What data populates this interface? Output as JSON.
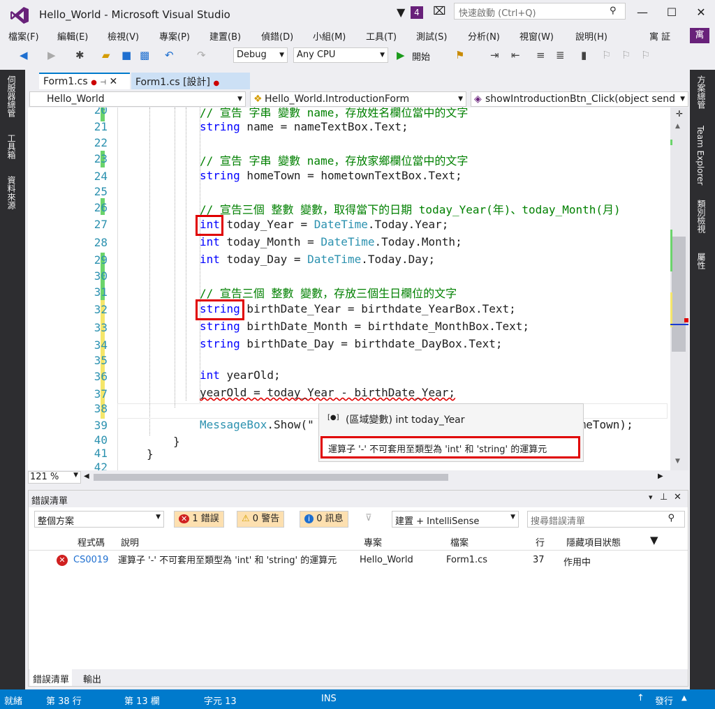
{
  "window": {
    "title": "Hello_World - Microsoft Visual Studio",
    "notif_count": "4",
    "quick_launch_placeholder": "快速啟動 (Ctrl+Q)",
    "user": "寓 証",
    "avatar": "寓"
  },
  "menu": [
    "檔案(F)",
    "編輯(E)",
    "檢視(V)",
    "專案(P)",
    "建置(B)",
    "偵錯(D)",
    "小組(M)",
    "工具(T)",
    "測試(S)",
    "分析(N)",
    "視窗(W)",
    "說明(H)"
  ],
  "toolbar": {
    "config": "Debug",
    "platform": "Any CPU",
    "start": "開始"
  },
  "left_tabs": [
    "伺服器總管",
    "工具箱",
    "資料來源"
  ],
  "right_tabs": [
    "方案總管",
    "Team Explorer",
    "類別檢視",
    "屬性"
  ],
  "doc_tabs": [
    {
      "label": "Form1.cs"
    },
    {
      "label": "Form1.cs [設計]"
    }
  ],
  "nav": {
    "project": "Hello_World",
    "class": "Hello_World.IntroductionForm",
    "member": "showIntroductionBtn_Click(object send"
  },
  "code": {
    "l20": "// 宣告 字串 變數 name，存放姓名欄位當中的文字",
    "l21a": "string",
    " l21b": " name = nameTextBox.Text;",
    "l23": "// 宣告 字串 變數 name，存放家鄉欄位當中的文字",
    "l24a": "string",
    "l24b": " homeTown = hometownTextBox.Text;",
    "l26": "// 宣告三個 整數 變數，取得當下的日期 today_Year(年)、today_Month(月)",
    "l27a": "int",
    "l27b": " today_Year = ",
    "l27c": "DateTime",
    ".l27d": ".Today.Year;",
    "l28a": "int",
    "l28b": " today_Month = ",
    "l28c": "DateTime",
    "l28d": ".Today.Month;",
    "l29a": "int",
    "l29b": " today_Day = ",
    "l29c": "DateTime",
    "l29d": ".Today.Day;",
    "l31": "// 宣告三個 整數 變數，存放三個生日欄位的文字",
    "l32a": "string",
    "l32b": " birthDate_Year = birthdate_YearBox.Text;",
    "l33a": "string",
    "l33b": " birthDate_Month = birthdate_MonthBox.Text;",
    "l34a": "string",
    "l34b": " birthDate_Day = birthdate_DayBox.Text;",
    "l36a": "int",
    "l36b": " yearOld;",
    "l37": "yearOld = today_Year - birthDate_Year;",
    "l39a": "MessageBox",
    "l39b": ".Show(\"",
    "l39c": "omeTown);",
    "l40": "}",
    "l41": "}"
  },
  "line_numbers": [
    "20",
    "21",
    "22",
    "23",
    "24",
    "25",
    "26",
    "27",
    "28",
    "29",
    "30",
    "31",
    "32",
    "33",
    "34",
    "35",
    "36",
    "37",
    "38",
    "39",
    "40",
    "41",
    "42"
  ],
  "tooltip": {
    "title": "(區域變數) int today_Year",
    "error": "運算子 '-' 不可套用至類型為 'int' 和 'string' 的運算元"
  },
  "zoom": "121 %",
  "errors": {
    "panel_title": "錯誤清單",
    "scope": "整個方案",
    "errors_btn": "1 錯誤",
    "warnings_btn": "0 警告",
    "messages_btn": "0 訊息",
    "build_filter": "建置 + IntelliSense",
    "search_placeholder": "搜尋錯誤清單",
    "headers": [
      "程式碼",
      "說明",
      "專案",
      "檔案",
      "行",
      "隱藏項目狀態"
    ],
    "rows": [
      {
        "code": "CS0019",
        "desc": "運算子 '-' 不可套用至類型為 'int' 和 'string' 的運算元",
        "project": "Hello_World",
        "file": "Form1.cs",
        "line": "37",
        "state": "作用中"
      }
    ],
    "tabs": [
      "錯誤清單",
      "輸出"
    ]
  },
  "status": {
    "ready": "就緒",
    "line": "第 38 行",
    "col": "第 13 欄",
    "char": "字元 13",
    "mode": "INS",
    "publish": "發行"
  }
}
